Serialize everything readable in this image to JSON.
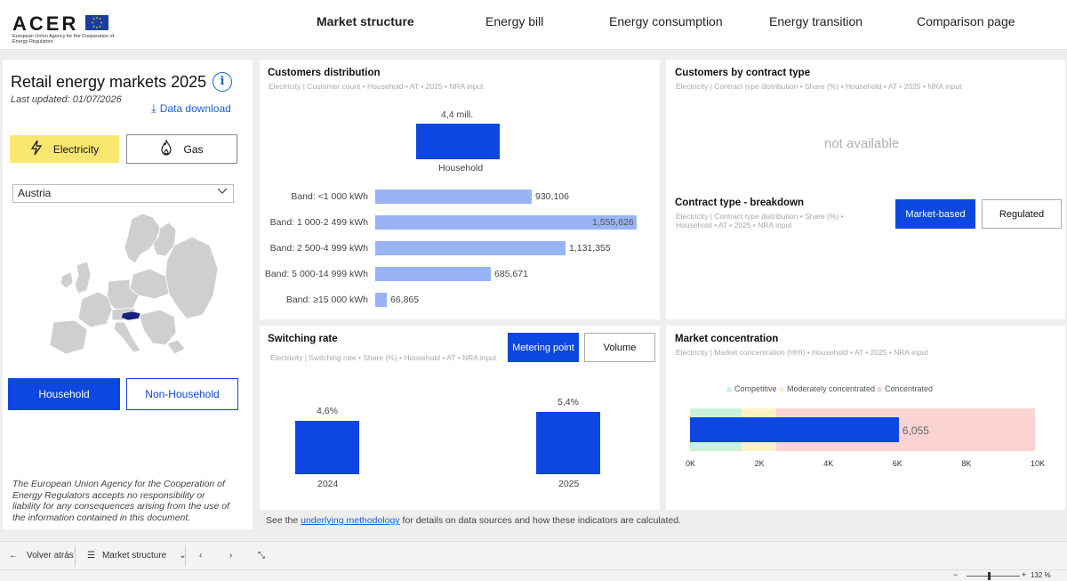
{
  "header": {
    "logo_text": "ACER",
    "logo_subtitle": "European Union Agency for the Cooperation of Energy Regulators",
    "nav": [
      {
        "label": "Market structure",
        "active": true
      },
      {
        "label": "Energy bill",
        "active": false
      },
      {
        "label": "Energy consumption",
        "active": false
      },
      {
        "label": "Energy transition",
        "active": false
      },
      {
        "label": "Comparison page",
        "active": false
      }
    ]
  },
  "sidebar": {
    "title": "Retail energy markets 2025",
    "info_icon": "i",
    "updated": "Last updated: 01/07/2026",
    "download_label": "Data download",
    "fuel_buttons": {
      "electricity": "Electricity",
      "gas": "Gas"
    },
    "country": "Austria",
    "segment_buttons": {
      "household": "Household",
      "non_household": "Non-Household"
    },
    "disclaimer": "The European Union Agency for the Cooperation of Energy Regulators accepts no responsibility or liability for any consequences arising from the use of the information contained in this document."
  },
  "customers_distribution": {
    "title": "Customers distribution",
    "subtitle": "Electricity | Customer count • Household • AT • 2025 • NRA input",
    "total_label": "4,4 mill.",
    "total_category": "Household",
    "bands": [
      {
        "label": "Band: <1 000 kWh",
        "value": 930106,
        "display": "930,106"
      },
      {
        "label": "Band: 1 000-2 499 kWh",
        "value": 1555626,
        "display": "1,555,626"
      },
      {
        "label": "Band: 2 500-4 999 kWh",
        "value": 1131355,
        "display": "1,131,355"
      },
      {
        "label": "Band: 5 000-14 999 kWh",
        "value": 685671,
        "display": "685,671"
      },
      {
        "label": "Band: ≥15 000 kWh",
        "value": 66865,
        "display": "66,865"
      }
    ]
  },
  "contract_type": {
    "title": "Customers by contract type",
    "subtitle": "Electricity | Contract type distribution • Share (%) • Household • AT • 2025 • NRA input",
    "not_available": "not available",
    "breakdown_title": "Contract type - breakdown",
    "breakdown_subtitle_1": "Electricity | Contract type distribution • Share (%) •",
    "breakdown_subtitle_2": "Household • AT • 2025 • NRA input",
    "btn_market": "Market-based",
    "btn_regulated": "Regulated"
  },
  "switching": {
    "title": "Switching rate",
    "subtitle": "Electricity | Switching rate • Share (%) • Household • AT • NRA input",
    "btn_metering": "Metering point",
    "btn_volume": "Volume",
    "bars": [
      {
        "year": "2024",
        "value": 4.6,
        "display": "4,6%"
      },
      {
        "year": "2025",
        "value": 5.4,
        "display": "5,4%"
      }
    ]
  },
  "concentration": {
    "title": "Market concentration",
    "subtitle": "Electricity | Market concentration (HHI) • Household • AT • 2025 • NRA input",
    "legend": [
      {
        "label": "Competitive",
        "color": "#c9f2d9"
      },
      {
        "label": "Moderately concentrated",
        "color": "#fbf2c4"
      },
      {
        "label": "Concentrated",
        "color": "#fbd3d3"
      }
    ],
    "value": 6055,
    "display": "6,055",
    "ticks": [
      "0K",
      "2K",
      "4K",
      "6K",
      "8K",
      "10K"
    ]
  },
  "footer": {
    "prefix": "See the ",
    "link": "underlying methodology",
    "suffix": " for details on data sources and how these indicators are calculated."
  },
  "bottombar": {
    "back": "Volver atrás",
    "page": "Market structure",
    "zoom": "132 %"
  },
  "colors": {
    "accent": "#0b47e0",
    "light_bar": "#98b4f5",
    "electricity": "#fae772"
  }
}
